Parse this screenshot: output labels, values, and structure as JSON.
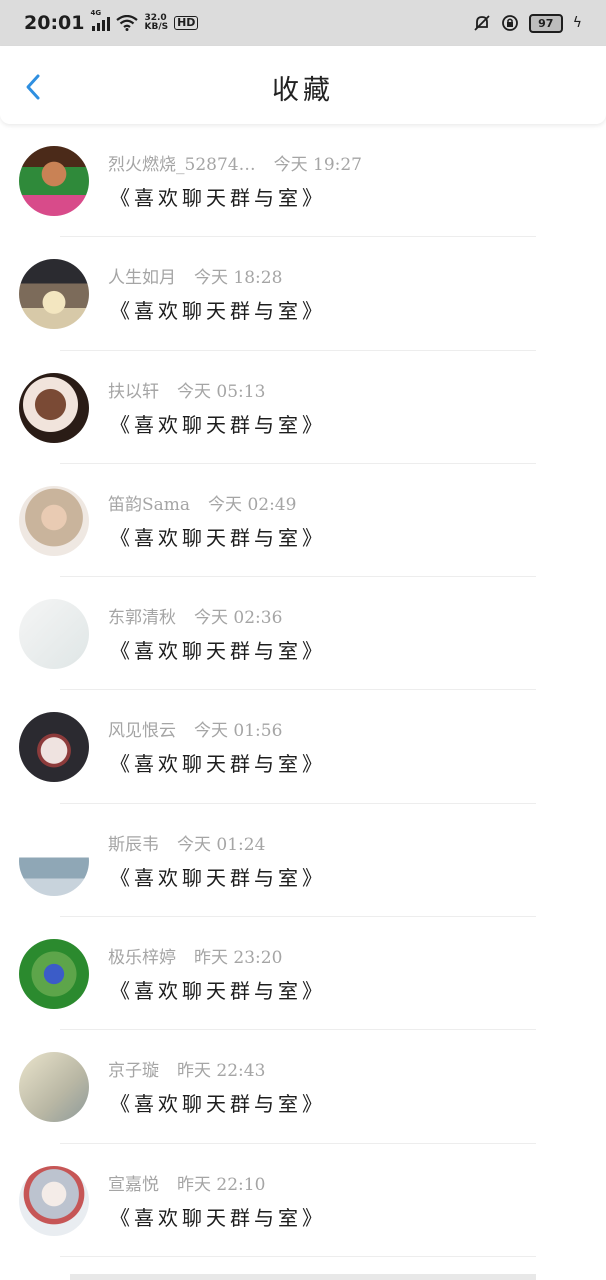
{
  "status_bar": {
    "time": "20:01",
    "network": "4G",
    "speed_value": "32.0",
    "speed_unit": "KB/S",
    "hd": "HD",
    "battery": "97"
  },
  "header": {
    "title": "收藏",
    "accent_color": "#2f8fe0"
  },
  "items": [
    {
      "name": "烈火燃烧_52874…",
      "time": "今天 19:27",
      "message": "《喜欢聊天群与室》"
    },
    {
      "name": "人生如月",
      "time": "今天 18:28",
      "message": "《喜欢聊天群与室》"
    },
    {
      "name": "扶以轩",
      "time": "今天 05:13",
      "message": "《喜欢聊天群与室》"
    },
    {
      "name": "笛韵Sama",
      "time": "今天 02:49",
      "message": "《喜欢聊天群与室》"
    },
    {
      "name": "东郭清秋",
      "time": "今天 02:36",
      "message": "《喜欢聊天群与室》"
    },
    {
      "name": "风见恨云",
      "time": "今天 01:56",
      "message": "《喜欢聊天群与室》"
    },
    {
      "name": "斯辰韦",
      "time": "今天 01:24",
      "message": "《喜欢聊天群与室》"
    },
    {
      "name": "极乐梓婷",
      "time": "昨天 23:20",
      "message": "《喜欢聊天群与室》"
    },
    {
      "name": "京子璇",
      "time": "昨天 22:43",
      "message": "《喜欢聊天群与室》"
    },
    {
      "name": "宣嘉悦",
      "time": "昨天 22:10",
      "message": "《喜欢聊天群与室》"
    }
  ]
}
